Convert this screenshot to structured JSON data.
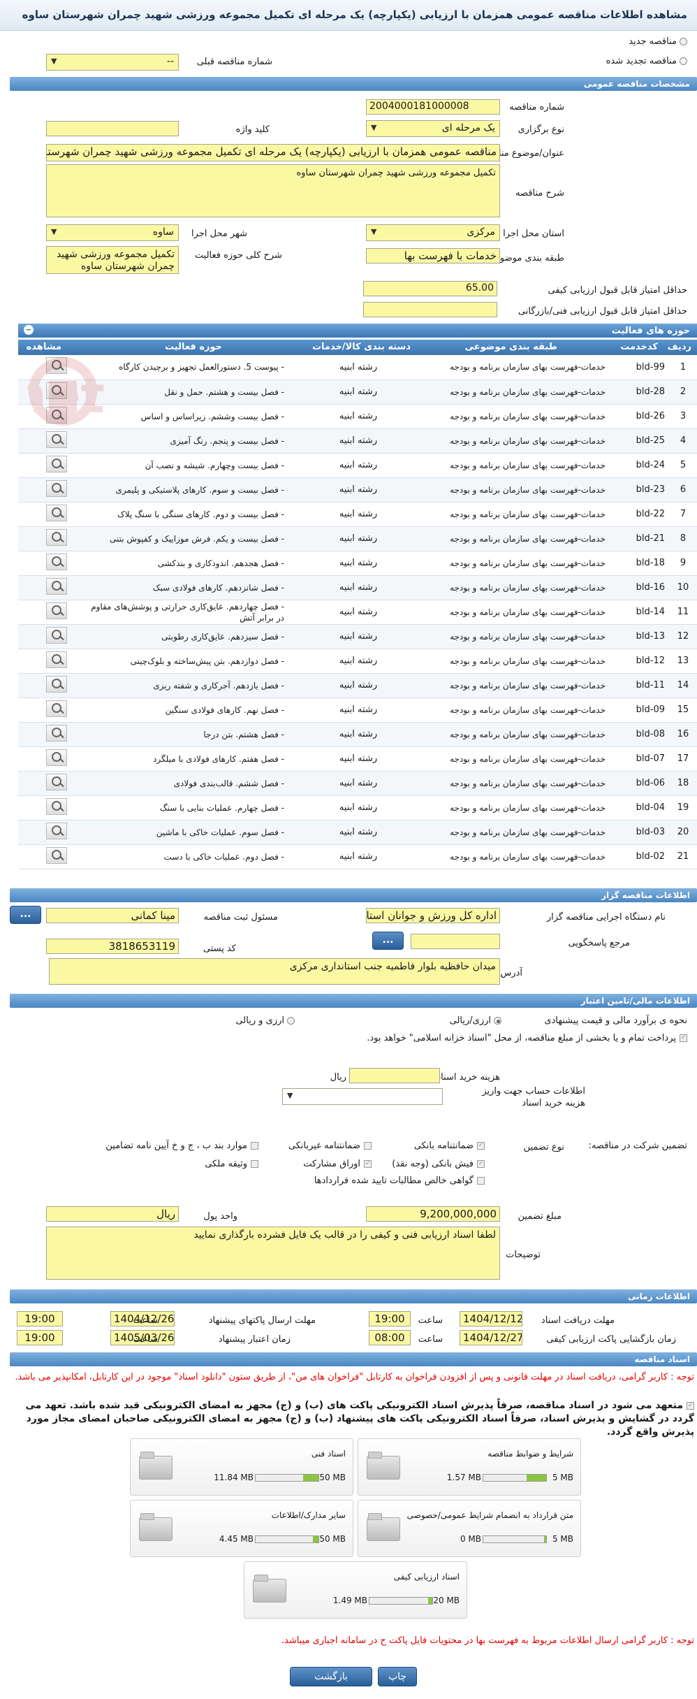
{
  "page_title": "مشاهده اطلاعات مناقصه عمومی همزمان با ارزیابی (یکپارچه) یک مرحله ای تکمیل مجموعه ورزشی شهید چمران شهرستان ساوه",
  "top": {
    "radio_new": "مناقصه جدید",
    "radio_renewed": "مناقصه تجدید شده",
    "prev_number_label": "شماره مناقصه قبلی",
    "prev_number_value": "--"
  },
  "general": {
    "header": "مشخصات مناقصه عمومی",
    "number_label": "شماره مناقصه",
    "number_value": "2004000181000008",
    "type_label": "نوع برگزاری",
    "type_value": "یک مرحله ای",
    "keyword_label": "کلید واژه",
    "keyword_value": "",
    "subject_label": "عنوان/موضوع مناقصه",
    "subject_value": "مناقصه عمومی همزمان با ارزیابی (یکپارچه) یک مرحله ای تکمیل مجموعه ورزشی شهید چمران شهرستان ساوه",
    "desc_label": "شرح مناقصه",
    "desc_value": "تکمیل مجموعه ورزشی شهید چمران شهرستان ساوه",
    "province_label": "استان محل اجرا",
    "province_value": "مرکزی",
    "city_label": "شهر محل اجرا",
    "city_value": "ساوه",
    "category_label": "طبقه بندی موضوعی",
    "category_value": "خدمات با فهرست بها",
    "scope_label": "شرح کلی حوزه فعالیت",
    "scope_value": "تکمیل مجموعه ورزشی شهید چمران شهرستان ساوه",
    "min_quality_label": "حداقل امتیاز قابل قبول ارزیابی کیفی",
    "min_quality_value": "65.00",
    "min_tech_label": "حداقل امتیاز قابل قبول ارزیابی فنی/بازرگانی",
    "min_tech_value": ""
  },
  "activity": {
    "header": "حوزه های فعالیت",
    "columns": [
      "ردیف",
      "کدخدمت",
      "طبقه بندی موضوعی",
      "دسته بندی کالا/خدمات",
      "حوزه فعالیت",
      "مشاهده"
    ],
    "rows": [
      {
        "n": "1",
        "code": "bld-99",
        "cat": "خدمات-فهرست بهای سازمان برنامه و بودجه",
        "kala": "رشته ابنیه",
        "act": "- پیوست 5. دستورالعمل تجهیز و برچیدن کارگاه"
      },
      {
        "n": "2",
        "code": "bld-28",
        "cat": "خدمات-فهرست بهای سازمان برنامه و بودجه",
        "kala": "رشته ابنیه",
        "act": "- فصل بیست و هشتم. حمل و نقل"
      },
      {
        "n": "3",
        "code": "bld-26",
        "cat": "خدمات-فهرست بهای سازمان برنامه و بودجه",
        "kala": "رشته ابنیه",
        "act": "- فصل بیست وششم. زیراساس و اساس"
      },
      {
        "n": "4",
        "code": "bld-25",
        "cat": "خدمات-فهرست بهای سازمان برنامه و بودجه",
        "kala": "رشته ابنیه",
        "act": "- فصل بیست و پنجم. رنگ آمیزی"
      },
      {
        "n": "5",
        "code": "bld-24",
        "cat": "خدمات-فهرست بهای سازمان برنامه و بودجه",
        "kala": "رشته ابنیه",
        "act": "- فصل بیست وچهارم. شیشه و نصب آن"
      },
      {
        "n": "6",
        "code": "bld-23",
        "cat": "خدمات-فهرست بهای سازمان برنامه و بودجه",
        "kala": "رشته ابنیه",
        "act": "- فصل بیست و سوم. کارهای پلاستیکی و پلیمری"
      },
      {
        "n": "7",
        "code": "bld-22",
        "cat": "خدمات-فهرست بهای سازمان برنامه و بودجه",
        "kala": "رشته ابنیه",
        "act": "- فصل بیست و دوم. کارهای سنگی با سنگ پلاک"
      },
      {
        "n": "8",
        "code": "bld-21",
        "cat": "خدمات-فهرست بهای سازمان برنامه و بودجه",
        "kala": "رشته ابنیه",
        "act": "- فصل بیست و یکم. فرش موزاییک و کفپوش بتنی"
      },
      {
        "n": "9",
        "code": "bld-18",
        "cat": "خدمات-فهرست بهای سازمان برنامه و بودجه",
        "kala": "رشته ابنیه",
        "act": "- فصل هجدهم. اندودکاری و بندکشی"
      },
      {
        "n": "10",
        "code": "bld-16",
        "cat": "خدمات-فهرست بهای سازمان برنامه و بودجه",
        "kala": "رشته ابنیه",
        "act": "- فصل شانزدهم. کارهای فولادی سبک"
      },
      {
        "n": "11",
        "code": "bld-14",
        "cat": "خدمات-فهرست بهای سازمان برنامه و بودجه",
        "kala": "رشته ابنیه",
        "act": "- فصل چهاردهم. عایق‌کاری حرارتی و پوشش‌های مقاوم در برابر آتش"
      },
      {
        "n": "12",
        "code": "bld-13",
        "cat": "خدمات-فهرست بهای سازمان برنامه و بودجه",
        "kala": "رشته ابنیه",
        "act": "- فصل سیزدهم. عایق‌کاری رطوبتی"
      },
      {
        "n": "13",
        "code": "bld-12",
        "cat": "خدمات-فهرست بهای سازمان برنامه و بودجه",
        "kala": "رشته ابنیه",
        "act": "- فصل دوازدهم. بتن پیش‌ساخته و بلوک‌چینی"
      },
      {
        "n": "14",
        "code": "bld-11",
        "cat": "خدمات-فهرست بهای سازمان برنامه و بودجه",
        "kala": "رشته ابنیه",
        "act": "- فصل یازدهم. آجرکاری و شفته ریزی"
      },
      {
        "n": "15",
        "code": "bld-09",
        "cat": "خدمات-فهرست بهای سازمان برنامه و بودجه",
        "kala": "رشته ابنیه",
        "act": "- فصل نهم. کارهای فولادی سنگین"
      },
      {
        "n": "16",
        "code": "bld-08",
        "cat": "خدمات-فهرست بهای سازمان برنامه و بودجه",
        "kala": "رشته ابنیه",
        "act": "- فصل هشتم. بتن درجا"
      },
      {
        "n": "17",
        "code": "bld-07",
        "cat": "خدمات-فهرست بهای سازمان برنامه و بودجه",
        "kala": "رشته ابنیه",
        "act": "- فصل هفتم. کارهای فولادی با میلگرد"
      },
      {
        "n": "18",
        "code": "bld-06",
        "cat": "خدمات-فهرست بهای سازمان برنامه و بودجه",
        "kala": "رشته ابنیه",
        "act": "- فصل ششم. قالب‌بندی فولادی"
      },
      {
        "n": "19",
        "code": "bld-04",
        "cat": "خدمات-فهرست بهای سازمان برنامه و بودجه",
        "kala": "رشته ابنیه",
        "act": "- فصل چهارم. عملیات بنایی با سنگ"
      },
      {
        "n": "20",
        "code": "bld-03",
        "cat": "خدمات-فهرست بهای سازمان برنامه و بودجه",
        "kala": "رشته ابنیه",
        "act": "- فصل سوم. عملیات خاکی با ماشین"
      },
      {
        "n": "21",
        "code": "bld-02",
        "cat": "خدمات-فهرست بهای سازمان برنامه و بودجه",
        "kala": "رشته ابنیه",
        "act": "- فصل دوم. عملیات خاکی با دست"
      }
    ]
  },
  "organizer": {
    "header": "اطلاعات مناقصه گزار",
    "org_label": "نام دستگاه اجرایی مناقصه گزار",
    "org_value": "اداره کل ورزش و جوانان استان مرکزی",
    "resp_label": "مسئول ثبت مناقصه",
    "resp_value": "مینا کمانی",
    "ref_label": "مرجع پاسخگویی",
    "ref_value": "",
    "postal_label": "کد پستی",
    "postal_value": "3818653119",
    "address_label": "آدرس",
    "address_value": "میدان حافظیه بلوار فاطمیه جنب استانداری مرکزی",
    "dots": "..."
  },
  "finance": {
    "header": "اطلاعات مالی/تامین اعتبار",
    "estimate_label": "نحوه ی برآورد مالی و قیمت پیشنهادی",
    "opt_rial_fx": "ارزی/ریالی",
    "opt_fx_and_rial": "ارزی و ریالی",
    "treasury_note": "پرداخت تمام و یا بخشی از مبلغ مناقصه، از محل \"اسناد خزانه اسلامی\" خواهد بود.",
    "doc_cost_label": "هزینه خرید اسناد",
    "doc_cost_value": "",
    "doc_cost_unit": "ریال",
    "account_label": "اطلاعات حساب جهت واریز هزینه خرید اسناد",
    "guarantee_section_label": "تضمین شرکت در مناقصه:",
    "guarantee_type_label": "نوع تضمین",
    "g_bank": "ضمانتنامه بانکی",
    "g_nonbank": "ضمانتنامه غیربانکی",
    "g_items": "موارد بند ب ، ج و خ آیین نامه تضامین",
    "g_cash": "فیش بانکی (وجه نقد)",
    "g_bonds": "اوراق مشارکت",
    "g_property": "وثیقه ملکی",
    "g_claims": "گواهی خالص مطالبات تایید شده قراردادها",
    "amount_label": "مبلغ تضمین",
    "amount_value": "9,200,000,000",
    "currency_label": "واحد پول",
    "currency_value": "ریال",
    "notes_label": "توضیحات",
    "notes_value": "لطفا اسناد ارزیابی فنی و کیفی را در قالب یک فایل فشرده بارگذاری نمایید"
  },
  "timing": {
    "header": "اطلاعات زمانی",
    "receive_label": "مهلت دریافت اسناد",
    "receive_date": "1404/12/12",
    "receive_time": "19:00",
    "send_label": "مهلت ارسال پاکتهای پیشنهاد",
    "send_date": "1404/12/26",
    "send_time": "19:00",
    "open_label": "زمان بازگشایی پاکت ارزیابی کیفی",
    "open_date": "1404/12/27",
    "open_time": "08:00",
    "validity_label": "زمان اعتبار پیشنهاد",
    "validity_date": "1405/03/26",
    "validity_time": "19:00",
    "time_word": "ساعت"
  },
  "docs": {
    "header": "اسناد مناقصه",
    "note_red": "توجه : کاربر گرامی، دریافت اسناد در مهلت قانونی و پس از افزودن فراخوان به کارتابل \"فراخوان های من\"، از طریق ستون \"دانلود اسناد\" موجود در این کارتابل، امکانپذیر می باشد.",
    "commit_note": "متعهد می شود در اسناد مناقصه، صرفاً پذیرش اسناد الکترونیکی پاکت های (ب) و (ج) مجهز به امضای الکترونیکی قید شده باشد. تعهد می گردد در گشایش و پذیرش اسناد، صرفاً اسناد الکترونیکی پاکت های پیشنهاد (ب) و (ج) مجهز به امضای الکترونیکی صاحبان امضای مجاز مورد پذیرش واقع گردد.",
    "files": [
      {
        "name": "شرایط و ضوابط مناقصه",
        "size": "1.57 MB",
        "max": "5 MB",
        "fill": 0.31
      },
      {
        "name": "اسناد فنی",
        "size": "11.84 MB",
        "max": "50 MB",
        "fill": 0.24
      },
      {
        "name": "متن قرارداد به انضمام شرایط عمومی/خصوصی",
        "size": "0 MB",
        "max": "5 MB",
        "fill": 0.0
      },
      {
        "name": "سایر مدارک/اطلاعات",
        "size": "4.45 MB",
        "max": "50 MB",
        "fill": 0.09
      },
      {
        "name": "اسناد ارزیابی کیفی",
        "size": "1.49 MB",
        "max": "20 MB",
        "fill": 0.07
      }
    ],
    "note_bottom": "توجه : کاربر گرامی ارسال اطلاعات مربوط به فهرست بها در محتویات فایل پاکت ج در سامانه اجباری میباشد."
  },
  "buttons": {
    "print": "چاپ",
    "back": "بازگشت"
  },
  "colors": {
    "accent": "#4a87c2",
    "field": "#fbf8a4",
    "danger": "#e60000"
  }
}
